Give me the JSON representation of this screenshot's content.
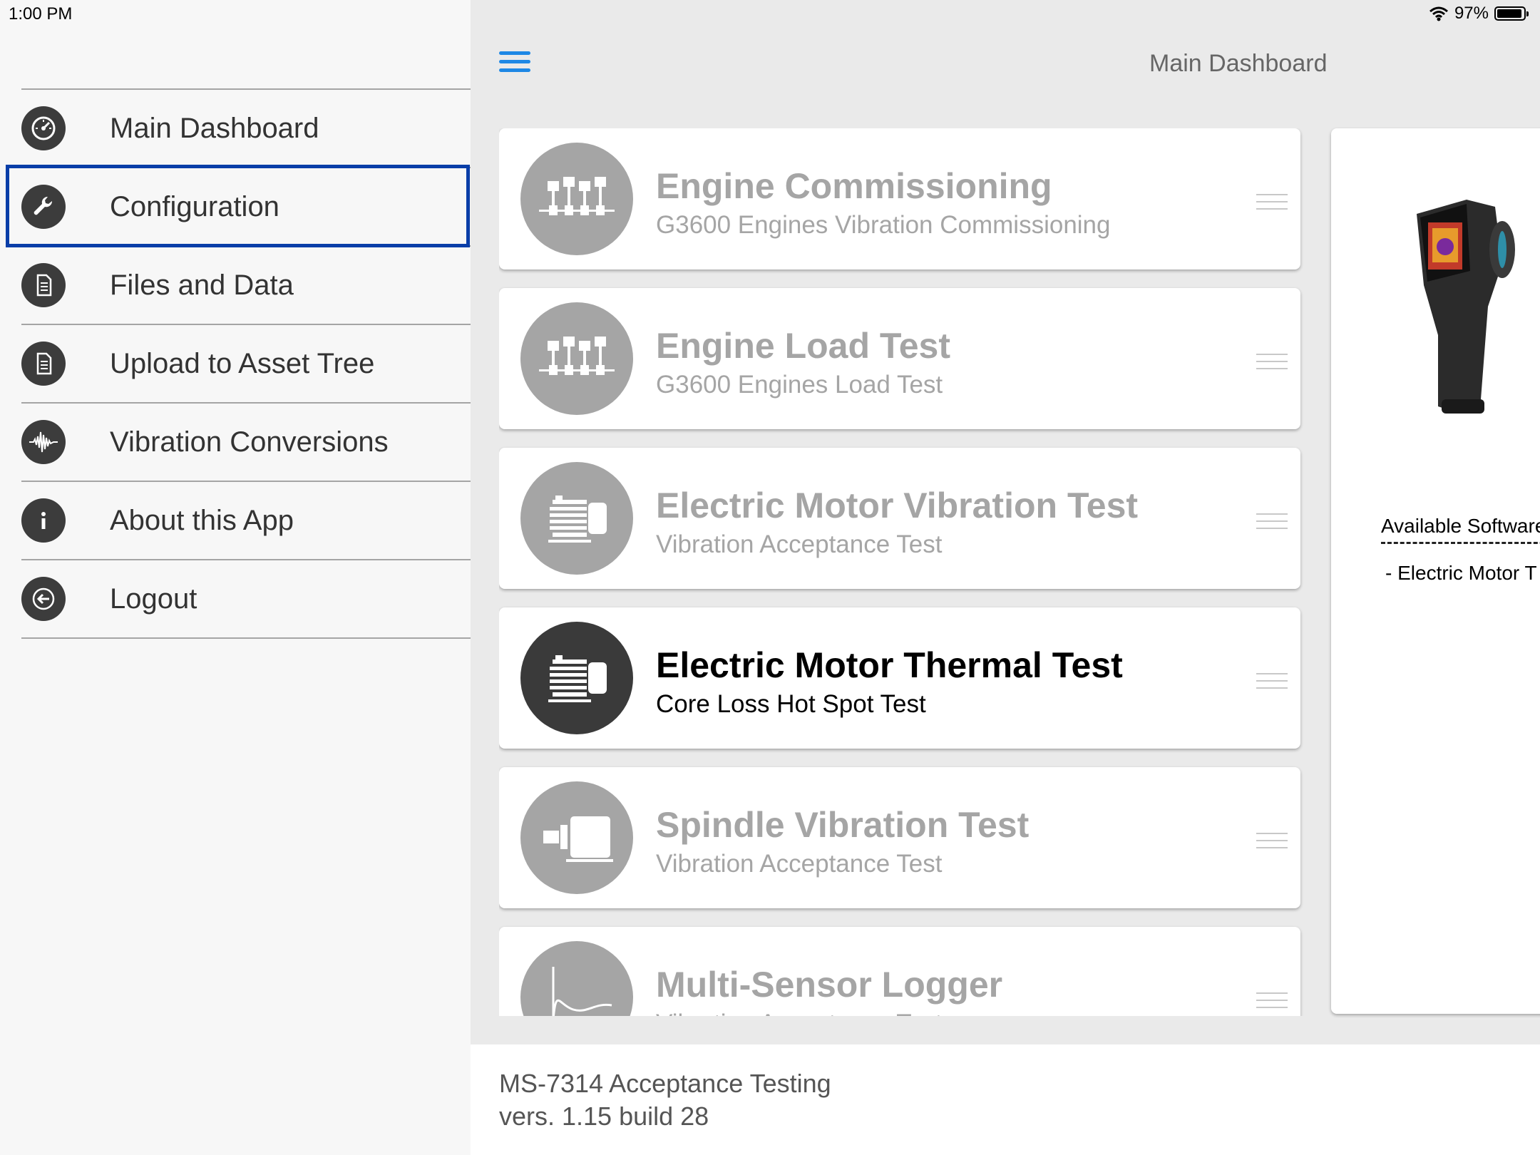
{
  "status_bar": {
    "time": "1:00 PM",
    "battery": "97%",
    "wifi_icon": "wifi-icon",
    "battery_icon": "battery-icon"
  },
  "sidebar": {
    "selected": "Configuration",
    "items": [
      {
        "label": "Main Dashboard",
        "icon": "speedometer-icon"
      },
      {
        "label": "Configuration",
        "icon": "wrench-icon"
      },
      {
        "label": "Files and Data",
        "icon": "document-icon"
      },
      {
        "label": "Upload to Asset Tree",
        "icon": "document-icon"
      },
      {
        "label": "Vibration Conversions",
        "icon": "waveform-icon"
      },
      {
        "label": "About this App",
        "icon": "info-icon"
      },
      {
        "label": "Logout",
        "icon": "logout-icon"
      }
    ]
  },
  "header": {
    "title": "Main Dashboard",
    "menu_icon": "hamburger-menu-icon"
  },
  "tests": [
    {
      "title": "Engine Commissioning",
      "subtitle": "G3600 Engines Vibration Commissioning",
      "icon": "engine-pistons-icon",
      "active": false
    },
    {
      "title": "Engine Load Test",
      "subtitle": "G3600 Engines Load Test",
      "icon": "engine-pistons-icon",
      "active": false
    },
    {
      "title": "Electric Motor Vibration Test",
      "subtitle": "Vibration Acceptance Test",
      "icon": "electric-motor-icon",
      "active": false
    },
    {
      "title": "Electric Motor Thermal Test",
      "subtitle": "Core Loss Hot Spot Test",
      "icon": "electric-motor-icon",
      "active": true
    },
    {
      "title": "Spindle Vibration Test",
      "subtitle": "Vibration Acceptance Test",
      "icon": "spindle-icon",
      "active": false
    },
    {
      "title": "Multi-Sensor Logger",
      "subtitle": "Vibration Acceptance Test",
      "icon": "curve-icon",
      "active": false
    }
  ],
  "detail_panel": {
    "available_title": "Available Software",
    "available_items": [
      "- Electric Motor T"
    ],
    "image": "thermal-camera-image"
  },
  "footer": {
    "app_name": "MS-7314 Acceptance Testing",
    "version": "vers. 1.15 build 28"
  },
  "colors": {
    "accent": "#1e88e5",
    "selection_border": "#0a3ea8",
    "icon_dark": "#3a3a3a",
    "icon_inactive": "#a5a5a5"
  }
}
